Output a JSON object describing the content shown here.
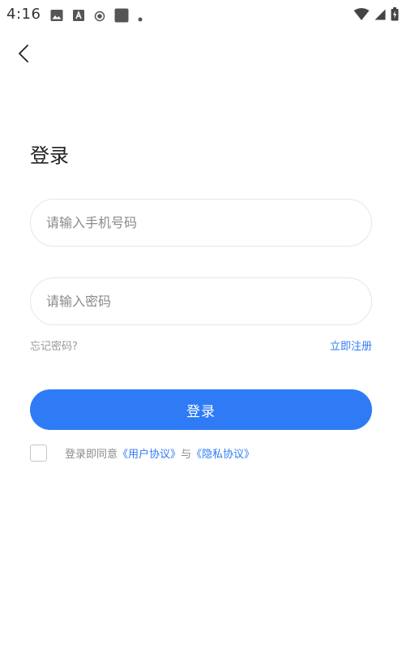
{
  "status_bar": {
    "time": "4:16",
    "icons_left": [
      "image-icon",
      "text-a-icon",
      "record-icon",
      "square-icon",
      "dot-icon"
    ],
    "icons_right": [
      "wifi-icon",
      "signal-icon",
      "battery-charging-icon"
    ]
  },
  "page": {
    "title": "登录"
  },
  "form": {
    "phone_placeholder": "请输入手机号码",
    "phone_value": "",
    "password_placeholder": "请输入密码",
    "password_value": "",
    "forgot_label": "忘记密码?",
    "register_label": "立即注册",
    "login_label": "登录"
  },
  "agreement": {
    "checked": false,
    "prefix": "登录即同意",
    "user_agreement": "《用户协议》",
    "connector": "与",
    "privacy_policy": "《隐私协议》"
  },
  "colors": {
    "accent": "#2f7bf6",
    "muted_text": "#999999",
    "input_border": "#e6e6e6"
  }
}
